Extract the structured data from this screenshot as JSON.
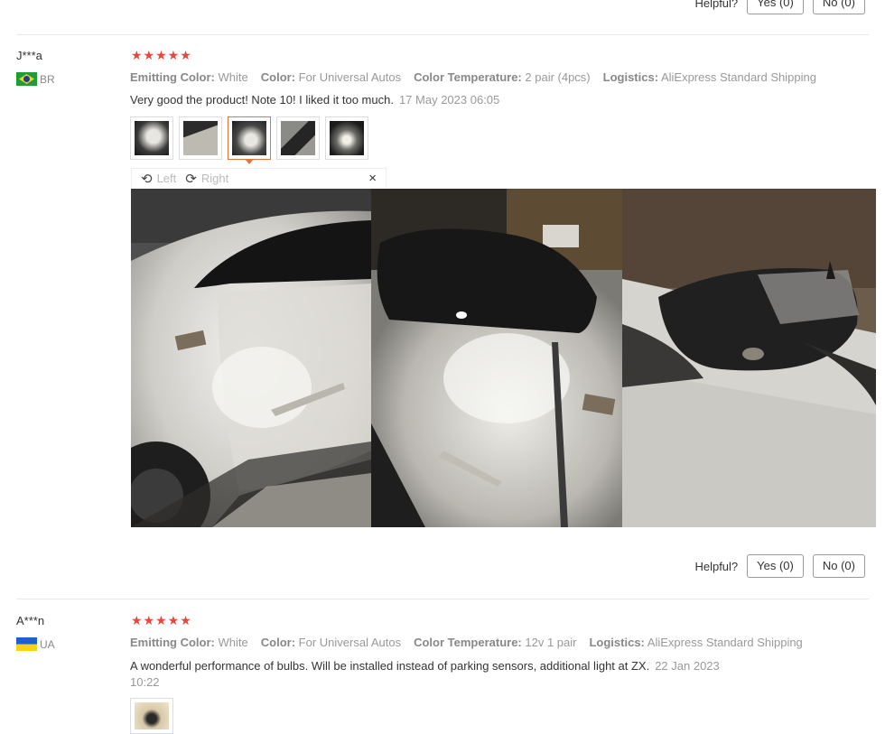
{
  "top_helpful": {
    "label": "Helpful?",
    "yes": "Yes (0)",
    "no": "No (0)"
  },
  "reviews": [
    {
      "name": "J***a",
      "country": "BR",
      "stars": "★★★★★",
      "attrs": [
        {
          "key": "Emitting Color:",
          "value": "White"
        },
        {
          "key": "Color:",
          "value": "For Universal Autos"
        },
        {
          "key": "Color Temperature:",
          "value": "2 pair (4pcs)"
        },
        {
          "key": "Logistics:",
          "value": "AliExpress Standard Shipping"
        }
      ],
      "text": "Very good the product! Note 10! I liked it too much.",
      "date": "17 May 2023 06:05",
      "viewer": {
        "left": "Left",
        "right": "Right",
        "close": "×"
      },
      "helpful": {
        "label": "Helpful?",
        "yes": "Yes (0)",
        "no": "No (0)"
      }
    },
    {
      "name": "A***n",
      "country": "UA",
      "stars": "★★★★★",
      "attrs": [
        {
          "key": "Emitting Color:",
          "value": "White"
        },
        {
          "key": "Color:",
          "value": "For Universal Autos"
        },
        {
          "key": "Color Temperature:",
          "value": "12v 1 pair"
        },
        {
          "key": "Logistics:",
          "value": "AliExpress Standard Shipping"
        }
      ],
      "text": "A wonderful performance of bulbs. Will be installed instead of parking sensors, additional light at ZX.",
      "date_line1": "22 Jan 2023",
      "date_line2": "10:22"
    }
  ]
}
